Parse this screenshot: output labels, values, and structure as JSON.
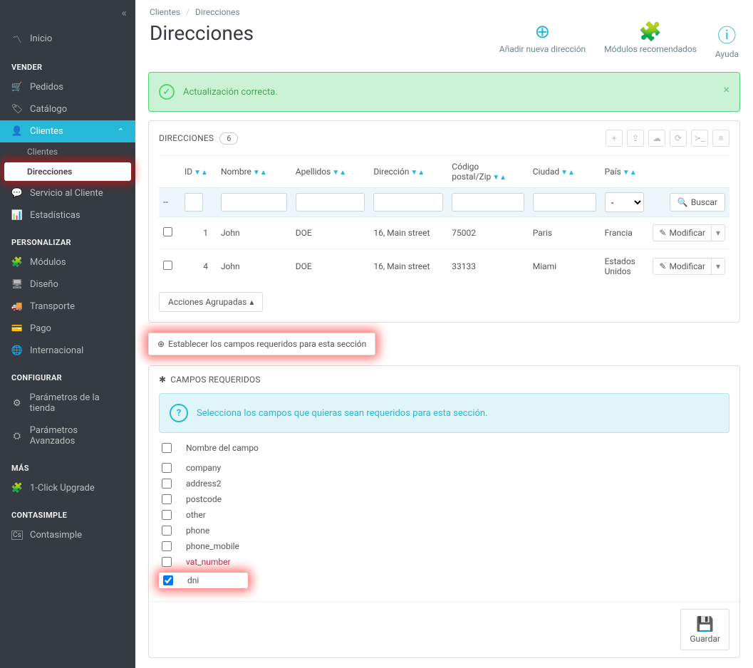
{
  "breadcrumb": {
    "parent": "Clientes",
    "current": "Direcciones"
  },
  "page": {
    "title": "Direcciones"
  },
  "toolbar": {
    "add": "Añadir nueva dirección",
    "modules": "Módulos recomendados",
    "help": "Ayuda"
  },
  "alert": {
    "message": "Actualización correcta.",
    "close": "×"
  },
  "sidebar": {
    "home": "Inicio",
    "sell_section": "VENDER",
    "orders": "Pedidos",
    "catalog": "Catálogo",
    "customers": "Clientes",
    "customers_sub": "Clientes",
    "addresses_sub": "Direcciones",
    "service": "Servicio al Cliente",
    "stats": "Estadísticas",
    "personalize_section": "PERSONALIZAR",
    "modules": "Módulos",
    "design": "Diseño",
    "transport": "Transporte",
    "payment": "Pago",
    "international": "Internacional",
    "config_section": "CONFIGURAR",
    "shop_params": "Parámetros de la tienda",
    "adv_params": "Parámetros Avanzados",
    "more_section": "MÁS",
    "upgrade": "1-Click Upgrade",
    "contasimple_section": "CONTASIMPLE",
    "contasimple": "Contasimple"
  },
  "table": {
    "title": "DIRECCIONES",
    "count": "6",
    "headers": {
      "id": "ID",
      "name": "Nombre",
      "surname": "Apellidos",
      "address": "Dirección",
      "zip": "Código postal/Zip",
      "city": "Ciudad",
      "country": "País"
    },
    "filter_dash": "--",
    "filter_select": "-",
    "search": "Buscar",
    "rows": [
      {
        "id": "1",
        "name": "John",
        "surname": "DOE",
        "address": "16, Main street",
        "zip": "75002",
        "city": "Paris",
        "country": "Francia"
      },
      {
        "id": "4",
        "name": "John",
        "surname": "DOE",
        "address": "16, Main street",
        "zip": "33133",
        "city": "Miami",
        "country": "Estados Unidos"
      }
    ],
    "modify": "Modificar",
    "bulk": "Acciones Agrupadas"
  },
  "required": {
    "button": "Establecer los campos requeridos para esta sección",
    "panel_title": "CAMPOS REQUERIDOS",
    "info": "Selecciona los campos que quieras sean requeridos para esta sección.",
    "header": "Nombre del campo",
    "fields": [
      {
        "name": "company",
        "checked": false
      },
      {
        "name": "address2",
        "checked": false
      },
      {
        "name": "postcode",
        "checked": false
      },
      {
        "name": "other",
        "checked": false
      },
      {
        "name": "phone",
        "checked": false
      },
      {
        "name": "phone_mobile",
        "checked": false
      },
      {
        "name": "vat_number",
        "checked": false,
        "red": true
      },
      {
        "name": "dni",
        "checked": true,
        "highlight": true
      }
    ],
    "save": "Guardar"
  }
}
